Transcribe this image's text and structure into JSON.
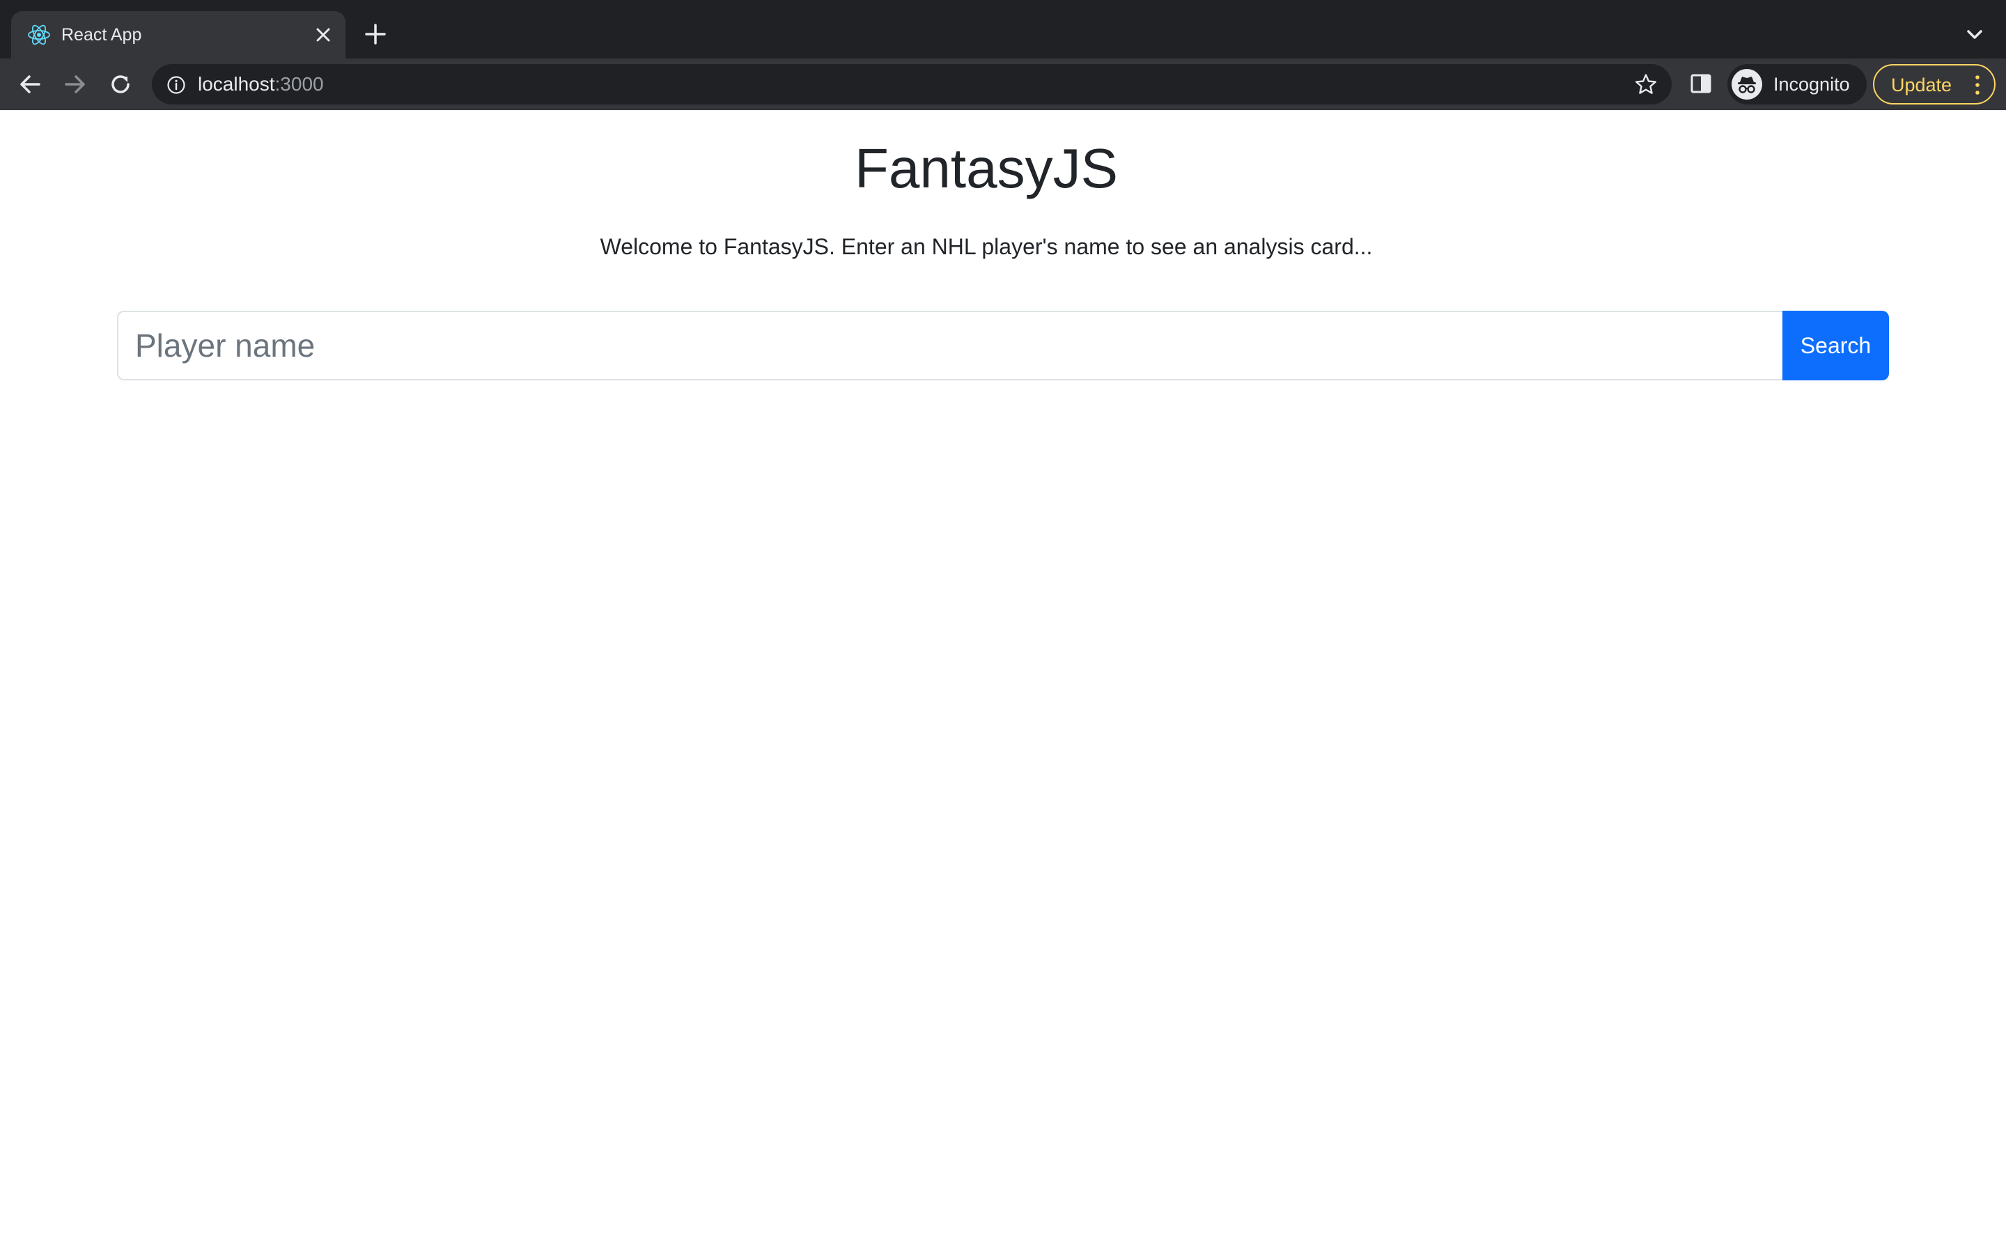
{
  "browser": {
    "tab": {
      "title": "React App",
      "favicon": "react-logo-icon"
    },
    "address_bar": {
      "host": "localhost",
      "port": ":3000"
    },
    "profile": {
      "label": "Incognito"
    },
    "update": {
      "label": "Update"
    }
  },
  "page": {
    "title": "FantasyJS",
    "welcome": "Welcome to FantasyJS. Enter an NHL player's name to see an analysis card...",
    "search": {
      "placeholder": "Player name",
      "value": "",
      "button_label": "Search"
    }
  },
  "colors": {
    "chrome_dark": "#202124",
    "chrome_toolbar": "#35363a",
    "update_accent": "#fdd663",
    "primary_button": "#0d6efd",
    "text": "#212529"
  }
}
